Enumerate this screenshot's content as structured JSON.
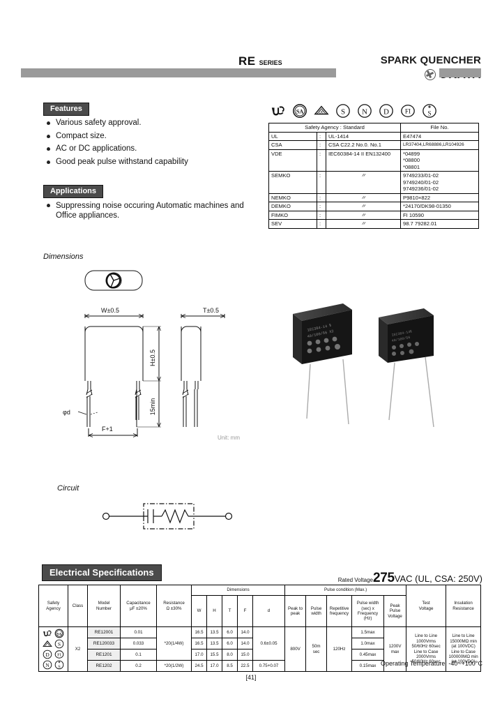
{
  "header": {
    "series": "RE",
    "series_suffix": "SERIES",
    "brand_tagline": "SPARK QUENCHER",
    "brand_name": "OKAYA",
    "brand_mark_icon": "okaya-logo-icon"
  },
  "features": {
    "tag": "Features",
    "items": [
      "Various safety approval.",
      "Compact size.",
      "AC or DC applications.",
      "Good peak pulse withstand capability"
    ]
  },
  "applications": {
    "tag": "Applications",
    "items": [
      "Suppressing noise occuring Automatic machines and Office appliances."
    ]
  },
  "agency_icons": [
    {
      "name": "ul-mark-icon",
      "label": "UL"
    },
    {
      "name": "csa-sa-mark-icon",
      "label": "SA"
    },
    {
      "name": "vde-mark-icon",
      "label": "VDE"
    },
    {
      "name": "semko-s-mark-icon",
      "label": "S"
    },
    {
      "name": "nemko-n-mark-icon",
      "label": "N"
    },
    {
      "name": "demko-d-mark-icon",
      "label": "D"
    },
    {
      "name": "fimko-fi-mark-icon",
      "label": "FI"
    },
    {
      "name": "sev-s-plus-mark-icon",
      "label": "S"
    }
  ],
  "safety_table": {
    "headers": {
      "standard": "Safety Agency : Standard",
      "file_no": "File No."
    },
    "rows": [
      {
        "agency": "UL",
        "colon": ":",
        "standard": "UL-1414",
        "files": [
          "E47474"
        ]
      },
      {
        "agency": "CSA",
        "colon": ":",
        "standard": "CSA C22.2 No.0. No.1",
        "files": [
          "LR37404,LR68886,LR104926"
        ]
      },
      {
        "agency": "VDE",
        "colon": ":",
        "standard": "IEC60384-14 II  EN132400",
        "files": [
          "*04899",
          "*08800",
          "*08801"
        ]
      },
      {
        "agency": "SEMKO",
        "colon": ":",
        "standard": "〃",
        "ditto": true,
        "files": [
          "9749233/01-02",
          "9749240/01-02",
          "9749236/01-02"
        ]
      },
      {
        "agency": "NEMKO",
        "colon": ":",
        "standard": "〃",
        "ditto": true,
        "files": [
          "P9810×822"
        ]
      },
      {
        "agency": "DEMKO",
        "colon": ":",
        "standard": "〃",
        "ditto": true,
        "files": [
          "*24170/DK98-01350"
        ]
      },
      {
        "agency": "FIMKO",
        "colon": ":",
        "standard": "〃",
        "ditto": true,
        "files": [
          "FI 10590"
        ]
      },
      {
        "agency": "SEV",
        "colon": ":",
        "standard": "〃",
        "ditto": true,
        "files": [
          "98.7 79282.01"
        ]
      }
    ]
  },
  "dimensions": {
    "label": "Dimensions",
    "unit_note": "Unit: mm",
    "callouts": {
      "width": "W±0.5",
      "thickness": "T±0.5",
      "height": "H±0.5",
      "lead_length": "15min",
      "lead_dia": "φd",
      "pitch": "F+1"
    }
  },
  "circuit": {
    "label": "Circuit"
  },
  "electrical": {
    "tag": "Electrical Specifications",
    "rated_voltage_label": "Rated Voltage",
    "rated_voltage_value": "275",
    "rated_voltage_unit": "VAC",
    "rated_voltage_note": "(UL, CSA: 250V)",
    "operating_temperature": "Operating Temperature: -40~+100°C",
    "page_number": "[41]",
    "headers": {
      "safety_agency": "Safety\nAgency",
      "class": "Class",
      "model_number": "Model\nNumber",
      "capacitance": "Capacitance\nμF ±20%",
      "resistance": "Resistance\nΩ ±30%",
      "dimensions_group": "Dimensions",
      "dim_w": "W",
      "dim_h": "H",
      "dim_t": "T",
      "dim_f": "F",
      "dim_d": "d",
      "pulse_group": "Pulse condition (Max.)",
      "peak_to_peak": "Peak to\npeak",
      "pulse_width": "Pulse\nwidth",
      "repetitive_frequency": "Repetitive\nfrequency",
      "pulse_width_freq": "Pulse width\n(sec) x\nFrequency\n(Hz)",
      "peak_pulse_voltage": "Peak\nPulse\nVoltage",
      "test_voltage": "Test\nVoltage",
      "insulation_resistance": "Insulation\nResistance"
    },
    "class_value": "X2",
    "rows": [
      {
        "model": "RE12001",
        "capacitance": "0.01",
        "resistance": "",
        "w": "16.5",
        "h": "13.5",
        "t": "6.0",
        "f": "14.0",
        "d": "",
        "pwf": "1.5max"
      },
      {
        "model": "RE120033",
        "capacitance": "0.033",
        "resistance": "*20(1/4W)",
        "w": "16.5",
        "h": "13.5",
        "t": "6.0",
        "f": "14.0",
        "d": "0.6±0.05",
        "pwf": "1.0max"
      },
      {
        "model": "RE1201",
        "capacitance": "0.1",
        "resistance": "",
        "w": "17.0",
        "h": "15.5",
        "t": "8.0",
        "f": "15.0",
        "d": "",
        "pwf": "0.45max"
      },
      {
        "model": "RE1202",
        "capacitance": "0.2",
        "resistance": "*20(1/2W)",
        "w": "24.5",
        "h": "17.0",
        "t": "8.5",
        "f": "22.5",
        "d": "0.75+0.07",
        "pwf": "0.15max"
      }
    ],
    "merged": {
      "peak_to_peak": "800V",
      "pulse_width": "50m\nsec",
      "repetitive_frequency": "120Hz",
      "peak_pulse_voltage": "1200V\nmax",
      "test_voltage": "Line to Line\n1000Vrms\n50/60Hz 60sec\nLine to Case\n2000Vrms\n50/60Hz 60sec",
      "insulation_resistance": "Line to Line\n15000MΩ min\n(at 100VDC)\nLine to Case\n100000MΩ min\n(at 100VDC)"
    }
  }
}
